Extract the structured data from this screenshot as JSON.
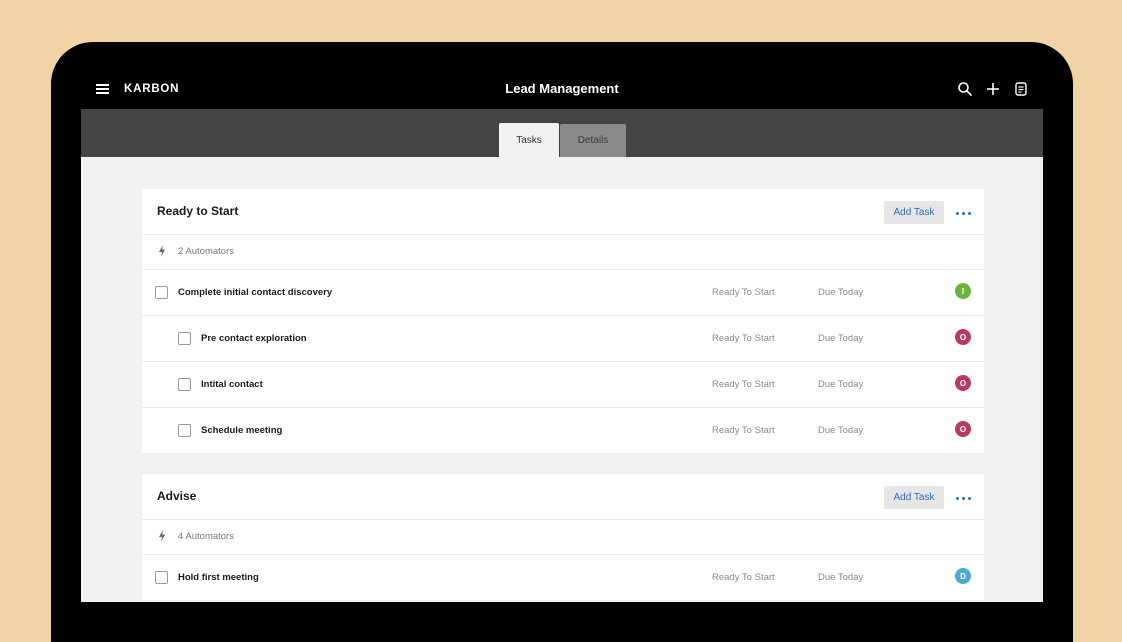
{
  "header": {
    "brand": "KARBON",
    "title": "Lead Management"
  },
  "tabs": [
    {
      "label": "Tasks",
      "active": true
    },
    {
      "label": "Details",
      "active": false
    }
  ],
  "icons": {
    "menu": "hamburger-icon",
    "search": "search-icon",
    "add": "plus-icon",
    "notes": "notes-icon",
    "automator": "lightning-bolt-icon",
    "more": "ellipsis-icon"
  },
  "colors": {
    "accent": "#2a6fc2",
    "avatar_green": "#6bb33a",
    "avatar_red": "#b83a5e",
    "avatar_blue": "#49abd0"
  },
  "sections": [
    {
      "title": "Ready to Start",
      "add_label": "Add Task",
      "automators": "2 Automators",
      "tasks": [
        {
          "name": "Complete initial contact discovery",
          "status": "Ready To Start",
          "due": "Due Today",
          "avatar": "I",
          "avatar_color": "#6bb33a",
          "indent": 0
        },
        {
          "name": "Pre contact exploration",
          "status": "Ready To Start",
          "due": "Due Today",
          "avatar": "O",
          "avatar_color": "#b83a5e",
          "indent": 1
        },
        {
          "name": "Intital contact",
          "status": "Ready To Start",
          "due": "Due Today",
          "avatar": "O",
          "avatar_color": "#b83a5e",
          "indent": 1
        },
        {
          "name": "Schedule meeting",
          "status": "Ready To Start",
          "due": "Due Today",
          "avatar": "O",
          "avatar_color": "#b83a5e",
          "indent": 1
        }
      ]
    },
    {
      "title": "Advise",
      "add_label": "Add Task",
      "automators": "4 Automators",
      "tasks": [
        {
          "name": "Hold first meeting",
          "status": "Ready To Start",
          "due": "Due Today",
          "avatar": "D",
          "avatar_color": "#49abd0",
          "indent": 0
        }
      ]
    }
  ]
}
